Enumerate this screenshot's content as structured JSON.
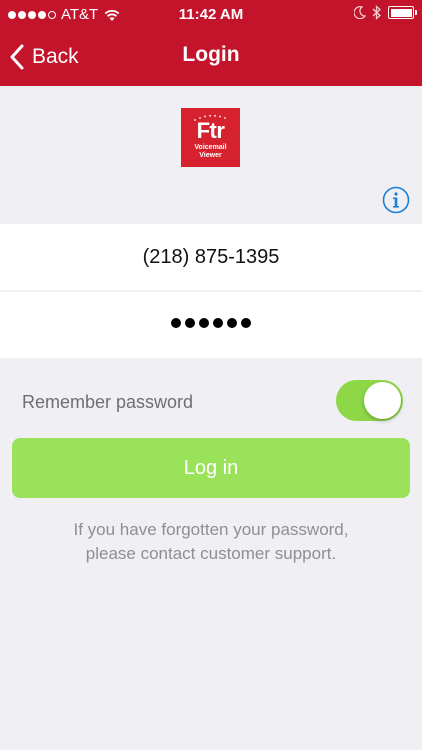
{
  "status_bar": {
    "carrier": "AT&T",
    "time": "11:42 AM"
  },
  "nav": {
    "back_label": "Back",
    "title": "Login"
  },
  "logo": {
    "main_text": "Ftr",
    "sub_line1": "Voicemail",
    "sub_line2": "Viewer",
    "color": "#d6222f"
  },
  "form": {
    "phone_value": "(218) 875-1395",
    "password_mask": "••••••",
    "remember_label": "Remember password",
    "remember_enabled": true,
    "login_label": "Log in"
  },
  "help": {
    "line1": "If you have forgotten your password,",
    "line2": "please contact customer support."
  },
  "colors": {
    "header": "#c4142c",
    "accent_green": "#9be25b",
    "toggle_on": "#8ed747",
    "info_blue": "#1a7fd6"
  }
}
